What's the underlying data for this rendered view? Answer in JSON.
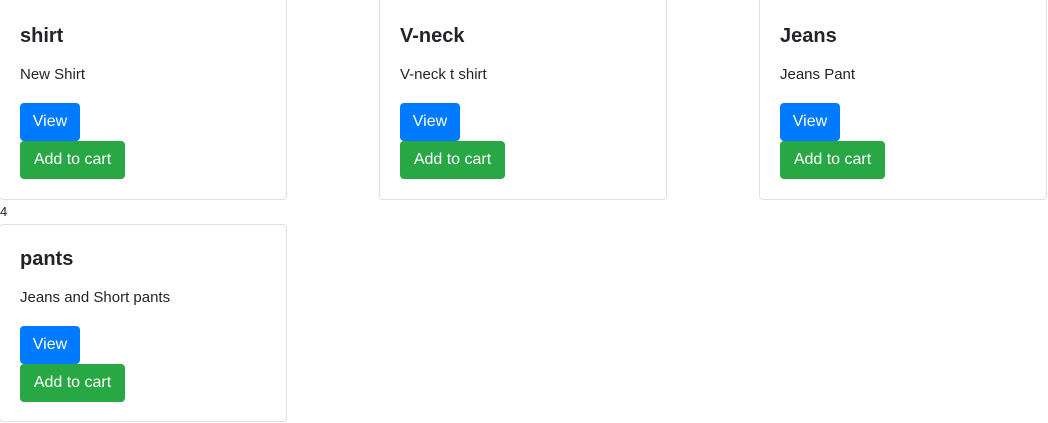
{
  "products": [
    {
      "title": "shirt",
      "description": "New Shirt",
      "view_label": "View",
      "cart_label": "Add to cart"
    },
    {
      "title": "V-neck",
      "description": "V-neck t shirt",
      "view_label": "View",
      "cart_label": "Add to cart"
    },
    {
      "title": "Jeans",
      "description": "Jeans Pant",
      "view_label": "View",
      "cart_label": "Add to cart"
    },
    {
      "title": "pants",
      "description": "Jeans and Short pants",
      "view_label": "View",
      "cart_label": "Add to cart"
    }
  ],
  "row_index": "4",
  "colors": {
    "view_button": "#007bff",
    "cart_button": "#28a745",
    "card_border": "#dfdfdf",
    "text": "#212529"
  }
}
